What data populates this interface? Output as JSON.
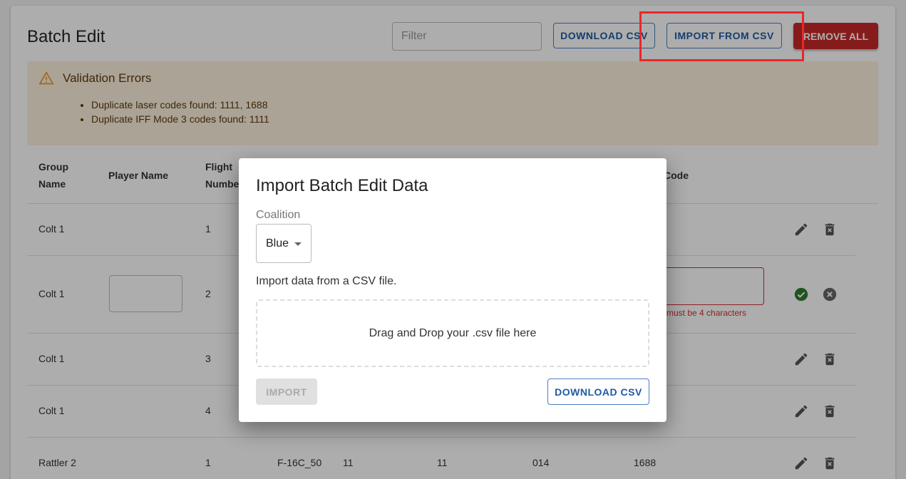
{
  "header": {
    "title": "Batch Edit",
    "filter_placeholder": "Filter",
    "download_csv": "DOWNLOAD CSV",
    "import_from_csv": "IMPORT FROM CSV",
    "remove_all": "REMOVE ALL"
  },
  "alert": {
    "title": "Validation Errors",
    "items": [
      "Duplicate laser codes found: 1111, 1688",
      "Duplicate IFF Mode 3 codes found: 1111"
    ]
  },
  "table": {
    "headers": {
      "group_name": "Group\nName",
      "player_name": "Player Name",
      "flight_number": "Flight\nNumber",
      "code": "Code"
    },
    "rows": [
      {
        "group": "Colt 1",
        "flight": "1"
      },
      {
        "group": "Colt 1",
        "flight": "2",
        "error": "must be 4 characters"
      },
      {
        "group": "Colt 1",
        "flight": "3"
      },
      {
        "group": "Colt 1",
        "flight": "4"
      },
      {
        "group": "Rattler 2",
        "flight": "1",
        "aircraft": "F-16C_50",
        "c1": "11",
        "c2": "11",
        "c3": "014",
        "code": "1688"
      }
    ]
  },
  "modal": {
    "title": "Import Batch Edit Data",
    "coalition_label": "Coalition",
    "coalition_value": "Blue",
    "description": "Import data from a CSV file.",
    "dropzone_text": "Drag and Drop your .csv file here",
    "import_label": "IMPORT",
    "download_label": "DOWNLOAD CSV"
  },
  "colors": {
    "primary": "#1f5aa6",
    "danger": "#c62828",
    "success": "#2e7d32",
    "warning_bg": "#fdf0dc",
    "highlight": "#e8282b"
  }
}
